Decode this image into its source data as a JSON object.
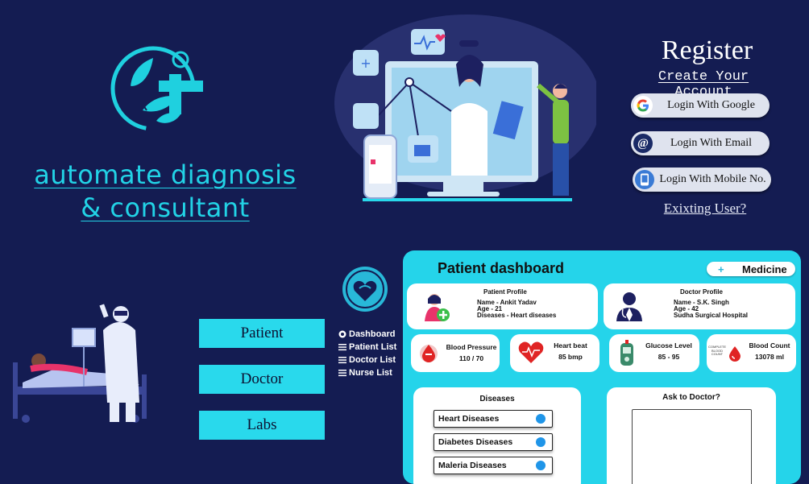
{
  "brand": {
    "line1": "automate diagnosis",
    "line2": "& consultant"
  },
  "register": {
    "title": "Register",
    "subtitle": "Create Your Account",
    "buttons": [
      {
        "label": "Login With Google",
        "icon": "google-icon"
      },
      {
        "label": "Login With Email",
        "icon": "at-icon"
      },
      {
        "label": "Login With Mobile No.",
        "icon": "phone-icon"
      }
    ],
    "existing": "Exixting User?"
  },
  "roles": [
    "Patient",
    "Doctor",
    "Labs"
  ],
  "sidebar": {
    "items": [
      {
        "label": "Dashboard",
        "icon": "dashboard-icon"
      },
      {
        "label": "Patient List",
        "icon": "list-icon"
      },
      {
        "label": "Doctor List",
        "icon": "list-icon"
      },
      {
        "label": "Nurse List",
        "icon": "list-icon"
      }
    ]
  },
  "dashboard": {
    "title": "Patient dashboard",
    "medicine_button": "Medicine",
    "patient_profile": {
      "heading": "Patient Profile",
      "name": "Name - Ankit Yadav",
      "age": "Age - 21",
      "diseases": "Diseases - Heart diseases"
    },
    "doctor_profile": {
      "heading": "Doctor Profile",
      "name": "Name - S.K. Singh",
      "age": "Age - 42",
      "hospital": "Sudha Surgical Hospital"
    },
    "vitals": [
      {
        "label": "Blood Pressure",
        "value": "110 / 70",
        "icon": "blood-drop-icon"
      },
      {
        "label": "Heart beat",
        "value": "85 bmp",
        "icon": "heart-icon"
      },
      {
        "label": "Glucose Level",
        "value": "85 - 95",
        "icon": "glucose-meter-icon"
      },
      {
        "label": "Blood Count",
        "value": "13078 ml",
        "icon": "blood-count-icon",
        "icon_text": "COMPLETE BLOOD COUNT"
      }
    ],
    "diseases": {
      "heading": "Diseases",
      "items": [
        "Heart Diseases",
        "Diabetes Diseases",
        "Maleria Diseases"
      ]
    },
    "ask": {
      "heading": "Ask to Doctor?"
    }
  },
  "colors": {
    "background": "#141c52",
    "accent": "#29d9ec",
    "dashboard": "#25d4ea",
    "bullet": "#1f95e8"
  }
}
